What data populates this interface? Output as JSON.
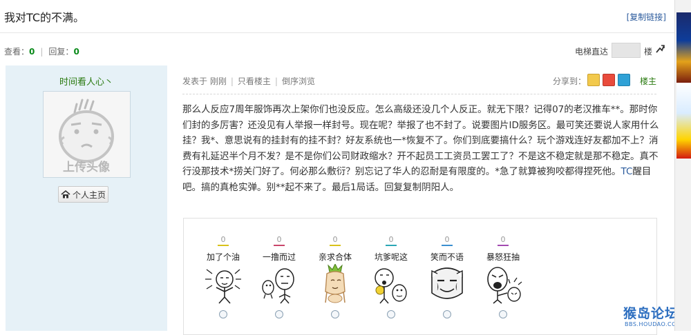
{
  "thread": {
    "title": "我对TC的不满。",
    "copy_link_label": "[复制链接]"
  },
  "stats": {
    "views_label": "查看：",
    "views_value": "0",
    "separator": "|",
    "replies_label": "回复：",
    "replies_value": "0"
  },
  "elevator": {
    "label": "电梯直达",
    "input_value": "",
    "floor_suffix": "楼"
  },
  "author": {
    "username": "时间看人心丶",
    "avatar_text": "上传头像",
    "home_button_label": "个人主页"
  },
  "post": {
    "meta": {
      "posted": "发表于 刚刚",
      "only_op": "只看楼主",
      "order": "倒序浏览",
      "sep": "|"
    },
    "share_label": "分享到：",
    "floor_label": "楼主",
    "content_part1": "那么人反应7周年服饰再次上架你们也没反应。怎么高级还没几个人反正。就无下限？记得07的老汉推车**。那时你们封的多厉害？还没见有人举报一样封号。现在呢？举报了也不封了。说要图片ID服务区。最可笑还要说人家用什么挂？我*、意思说有的挂封有的挂不封？好友系统也一*恢复不了。你们到底要搞什么？玩个游戏连好友都加不上？消费有礼延迟半个月不发？是不是你们公司财政缩水？开不起员工工资员工罢工了？不是这不稳定就是那不稳定。真不行没那技术*捞关门好了。何必那么敷衍？别忘记了华人的忍耐是有限度的。*急了就算被狗咬都得捏死他。",
    "content_tc": "TC",
    "content_part2": "醒目吧。搞的真枪实弹。别**起不来了。最后1局话。回复复制阴阳人。"
  },
  "reactions": [
    {
      "label": "加了个油",
      "count": "0",
      "color": "#d9c21a"
    },
    {
      "label": "一撸而过",
      "count": "0",
      "color": "#c9466a"
    },
    {
      "label": "亲求合体",
      "count": "0",
      "color": "#d9c21a"
    },
    {
      "label": "坑爹呢这",
      "count": "0",
      "color": "#2aa7b5"
    },
    {
      "label": "笑而不语",
      "count": "0",
      "color": "#3a8fd0"
    },
    {
      "label": "暴怒狂抽",
      "count": "0",
      "color": "#a24ab0"
    }
  ],
  "watermark": {
    "name": "猴岛论坛",
    "url": "BBS.HOUDAO.COM"
  },
  "colors": {
    "sidebar_bg": "#e6f1f7",
    "username_green": "#2a7a10",
    "link_blue": "#2a5a9c"
  }
}
